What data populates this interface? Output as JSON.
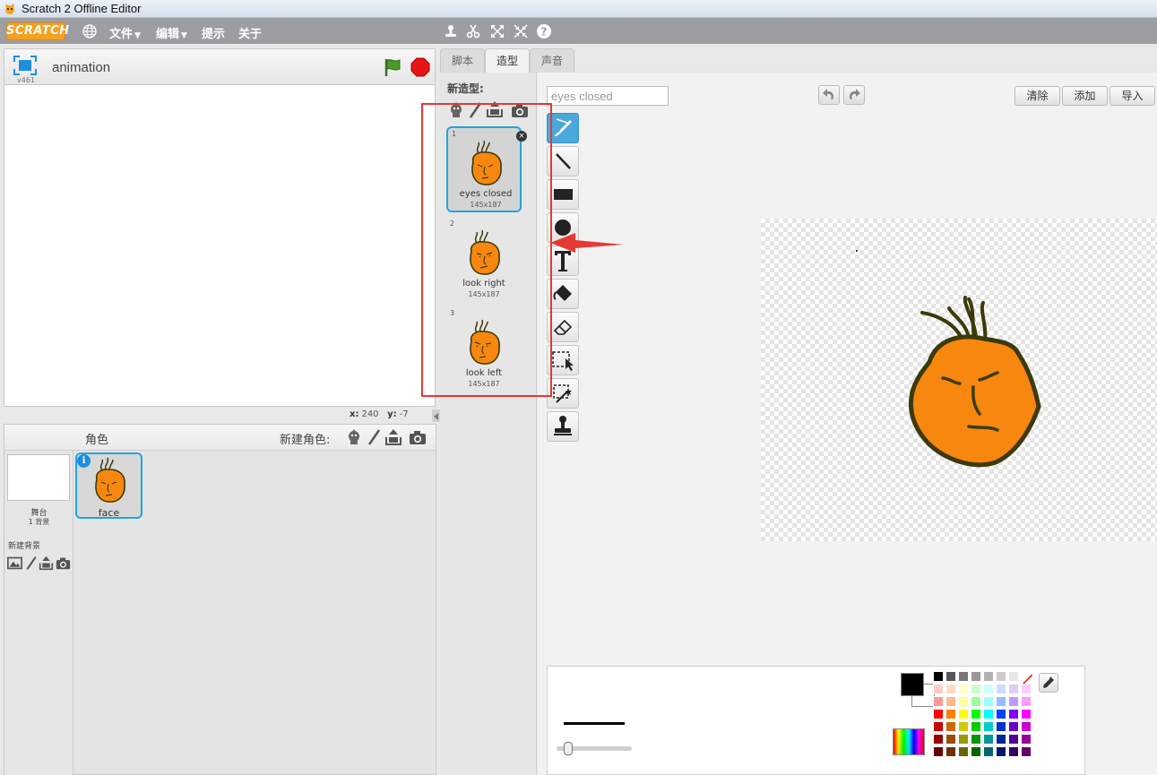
{
  "window": {
    "title": "Scratch 2 Offline Editor"
  },
  "menubar": {
    "logo_text": "SCRATCH",
    "items": [
      {
        "label": "文件",
        "has_caret": true
      },
      {
        "label": "编辑",
        "has_caret": true
      },
      {
        "label": "提示",
        "has_caret": false
      },
      {
        "label": "关于",
        "has_caret": false
      }
    ],
    "tool_icons": [
      "duplicate-icon",
      "cut-icon",
      "grow-icon",
      "shrink-icon",
      "help-icon"
    ]
  },
  "stage": {
    "project_title": "animation",
    "version": "v461",
    "coords": {
      "x_label": "x:",
      "x": "240",
      "y_label": "y:",
      "y": "-7"
    }
  },
  "sprites": {
    "header_label": "角色",
    "new_sprite_label": "新建角色:",
    "stage_thumb": {
      "label": "舞台",
      "sublabel": "1 背景"
    },
    "new_backdrop_label": "新建背景",
    "items": [
      {
        "name": "face"
      }
    ]
  },
  "tabs": [
    {
      "label": "脚本",
      "active": false
    },
    {
      "label": "造型",
      "active": true
    },
    {
      "label": "声音",
      "active": false
    }
  ],
  "costumes": {
    "new_costume_label": "新造型:",
    "items": [
      {
        "num": "1",
        "name": "eyes closed",
        "size": "145x187",
        "selected": true
      },
      {
        "num": "2",
        "name": "look right",
        "size": "145x187",
        "selected": false
      },
      {
        "num": "3",
        "name": "look left",
        "size": "145x187",
        "selected": false
      }
    ]
  },
  "paint_editor": {
    "costume_name": "eyes closed",
    "buttons": {
      "clear": "清除",
      "add": "添加",
      "import": "导入"
    },
    "tools": [
      "brush",
      "line",
      "rectangle",
      "ellipse",
      "text",
      "fill",
      "eraser",
      "select",
      "magic-select",
      "stamp"
    ]
  },
  "colors": {
    "menubar": "#9c9ea2",
    "selection_blue": "#23a3e0",
    "face_orange": "#f7870e",
    "face_outline": "#3d3a0a",
    "annotation_red": "#e53935"
  }
}
